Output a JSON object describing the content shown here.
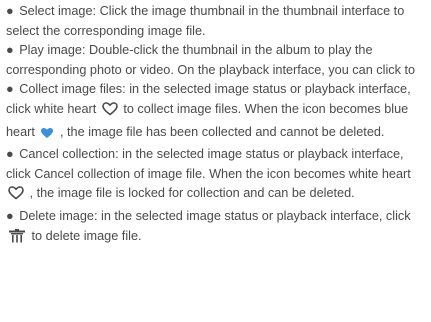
{
  "document": {
    "bullet": "●",
    "items": [
      {
        "text": "Select image: Click the image thumbnail in the thumbnail interface to select the corresponding image file."
      },
      {
        "text": "Play image: Double-click the thumbnail in the album to play the corresponding photo or video. On the playback interface, you can click to"
      },
      {
        "text_before": "Collect image files: in the selected image status or playback interface, click white heart",
        "icon_1": "white-heart-icon",
        "text_middle": "to collect image files. When the icon becomes blue heart",
        "icon_2": "blue-heart-icon",
        "text_after": ", the image file has been collected and cannot be deleted."
      },
      {
        "text_before": "Cancel collection: in the selected image status or playback interface, click Cancel collection of image file. When the icon becomes white heart",
        "icon": "white-heart-icon",
        "text_after": ", the image file is locked for collection and can be deleted."
      },
      {
        "text_before": "Delete image: in the selected image status or playback interface, click",
        "icon": "trash-icon",
        "text_after": "to delete image file."
      }
    ]
  },
  "colors": {
    "text": "#4a4a4a",
    "heart_outline": "#4a4a4a",
    "heart_fill": "#3b8fd8",
    "trash": "#4a4a4a"
  }
}
